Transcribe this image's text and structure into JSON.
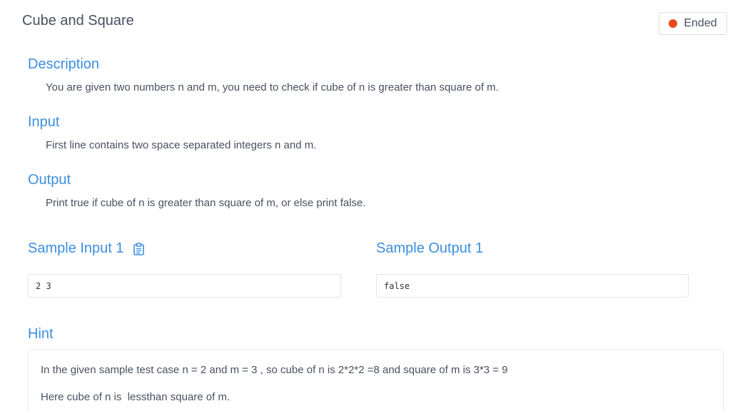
{
  "problem": {
    "title": "Cube and Square",
    "status": "Ended",
    "status_color": "#e84a1b",
    "accent_color": "#3c8ee0"
  },
  "description": {
    "heading": "Description",
    "text": "You are given two numbers n and m, you need to check if cube of n is greater than square of m."
  },
  "input": {
    "heading": "Input",
    "text": "First line contains two space separated integers n and m."
  },
  "output": {
    "heading": "Output",
    "text": "Print true if cube of n is greater than square of m, or else print false."
  },
  "samples": {
    "input_heading": "Sample Input 1",
    "input_value": "2 3",
    "copy_icon": "clipboard-icon",
    "output_heading": "Sample Output 1",
    "output_value": "false"
  },
  "hint": {
    "heading": "Hint",
    "line1": "In the given sample test case n = 2 and m = 3 , so cube of n is 2*2*2 =8 and square of m is 3*3 = 9",
    "line2": "Here cube of n is  lessthan square of m."
  }
}
